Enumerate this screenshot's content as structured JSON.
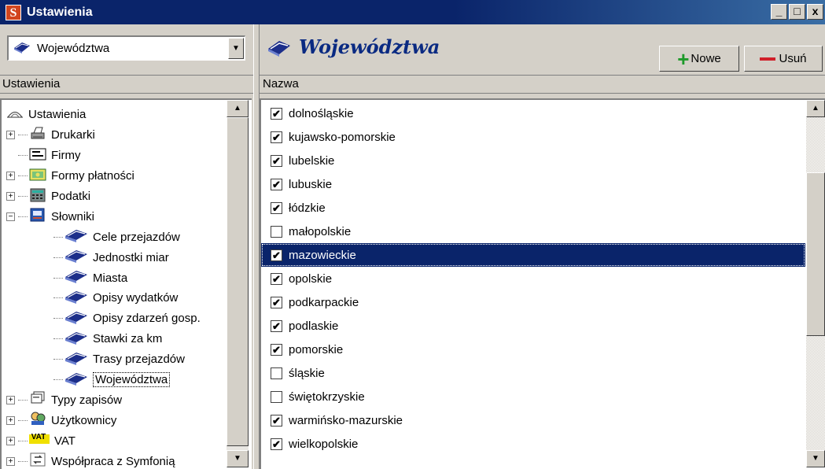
{
  "window": {
    "app_icon_letter": "S",
    "title": "Ustawienia",
    "minimize": "_",
    "maximize": "□",
    "close": "x"
  },
  "left": {
    "combo_value": "Województwa",
    "header": "Ustawienia",
    "tree": [
      {
        "label": "Ustawienia",
        "level": 0,
        "icon": "settings-hat-icon",
        "expander": ""
      },
      {
        "label": "Drukarki",
        "level": 1,
        "icon": "printer-icon",
        "expander": "+"
      },
      {
        "label": "Firmy",
        "level": 1,
        "icon": "company-card-icon",
        "expander": ""
      },
      {
        "label": "Formy płatności",
        "level": 1,
        "icon": "payment-icon",
        "expander": "+"
      },
      {
        "label": "Podatki",
        "level": 1,
        "icon": "calculator-icon",
        "expander": "+"
      },
      {
        "label": "Słowniki",
        "level": 1,
        "icon": "dictionary-icon",
        "expander": "−"
      },
      {
        "label": "Cele przejazdów",
        "level": 2,
        "icon": "book-icon",
        "expander": ""
      },
      {
        "label": "Jednostki miar",
        "level": 2,
        "icon": "book-icon",
        "expander": ""
      },
      {
        "label": "Miasta",
        "level": 2,
        "icon": "book-icon",
        "expander": ""
      },
      {
        "label": "Opisy wydatków",
        "level": 2,
        "icon": "book-icon",
        "expander": ""
      },
      {
        "label": "Opisy zdarzeń gosp.",
        "level": 2,
        "icon": "book-icon",
        "expander": ""
      },
      {
        "label": "Stawki za km",
        "level": 2,
        "icon": "book-icon",
        "expander": ""
      },
      {
        "label": "Trasy przejazdów",
        "level": 2,
        "icon": "book-icon",
        "expander": ""
      },
      {
        "label": "Województwa",
        "level": 2,
        "icon": "book-icon",
        "expander": "",
        "selected": true
      },
      {
        "label": "Typy zapisów",
        "level": 1,
        "icon": "records-icon",
        "expander": "+"
      },
      {
        "label": "Użytkownicy",
        "level": 1,
        "icon": "users-icon",
        "expander": "+"
      },
      {
        "label": "VAT",
        "level": 1,
        "icon": "vat-icon",
        "expander": "+"
      },
      {
        "label": "Współpraca z Symfonią",
        "level": 1,
        "icon": "sync-icon",
        "expander": "+"
      }
    ]
  },
  "right": {
    "title": "Województwa",
    "new_label": "Nowe",
    "delete_label": "Usuń",
    "column_header": "Nazwa",
    "rows": [
      {
        "name": "dolnośląskie",
        "checked": true
      },
      {
        "name": "kujawsko-pomorskie",
        "checked": true
      },
      {
        "name": "lubelskie",
        "checked": true
      },
      {
        "name": "lubuskie",
        "checked": true
      },
      {
        "name": "łódzkie",
        "checked": true
      },
      {
        "name": "małopolskie",
        "checked": false
      },
      {
        "name": "mazowieckie",
        "checked": true,
        "selected": true
      },
      {
        "name": "opolskie",
        "checked": true
      },
      {
        "name": "podkarpackie",
        "checked": true
      },
      {
        "name": "podlaskie",
        "checked": true
      },
      {
        "name": "pomorskie",
        "checked": true
      },
      {
        "name": "śląskie",
        "checked": false
      },
      {
        "name": "świętokrzyskie",
        "checked": false
      },
      {
        "name": "warmińsko-mazurskie",
        "checked": true
      },
      {
        "name": "wielkopolskie",
        "checked": true
      }
    ]
  },
  "colors": {
    "titlebar": "#0a246a",
    "selection": "#0a246a",
    "face": "#d4d0c8",
    "title_text": "#0a2a82"
  }
}
